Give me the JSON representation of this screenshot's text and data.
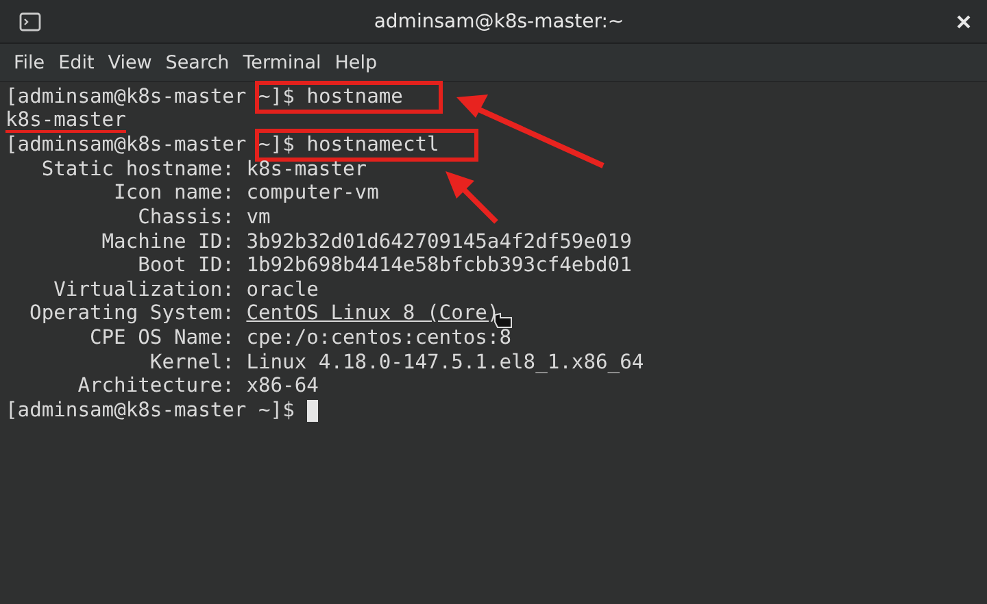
{
  "window": {
    "title": "adminsam@k8s-master:~"
  },
  "menu": [
    "File",
    "Edit",
    "View",
    "Search",
    "Terminal",
    "Help"
  ],
  "terminal": {
    "lines": [
      {
        "kind": "prompt",
        "host": "[adminsam@k8s-master",
        "cwd": "~]$",
        "command": "hostname",
        "boxed": true
      },
      {
        "kind": "output",
        "text": "k8s-master",
        "underlined": true
      },
      {
        "kind": "prompt",
        "host": "[adminsam@k8s-master",
        "cwd": "~]$",
        "command": "hostnamectl",
        "boxed": true
      },
      {
        "kind": "field",
        "label": "Static hostname:",
        "value": "k8s-master",
        "hovered": false
      },
      {
        "kind": "field",
        "label": "Icon name:",
        "value": "computer-vm",
        "hovered": false
      },
      {
        "kind": "field",
        "label": "Chassis:",
        "value": "vm",
        "hovered": false
      },
      {
        "kind": "field",
        "label": "Machine ID:",
        "value": "3b92b32d01d642709145a4f2df59e019",
        "hovered": false
      },
      {
        "kind": "field",
        "label": "Boot ID:",
        "value": "1b92b698b4414e58bfcbb393cf4ebd01",
        "hovered": false
      },
      {
        "kind": "field",
        "label": "Virtualization:",
        "value": "oracle",
        "hovered": false
      },
      {
        "kind": "field",
        "label": "Operating System:",
        "value": "CentOS Linux 8 (Core)",
        "hovered": true
      },
      {
        "kind": "field",
        "label": "CPE OS Name:",
        "value": "cpe:/o:centos:centos:8",
        "hovered": false
      },
      {
        "kind": "field",
        "label": "Kernel:",
        "value": "Linux 4.18.0-147.5.1.el8_1.x86_64",
        "hovered": false
      },
      {
        "kind": "field",
        "label": "Architecture:",
        "value": "x86-64",
        "hovered": false
      },
      {
        "kind": "prompt",
        "host": "[adminsam@k8s-master",
        "cwd": "~]$",
        "boxed": false,
        "cursor": true
      }
    ]
  }
}
